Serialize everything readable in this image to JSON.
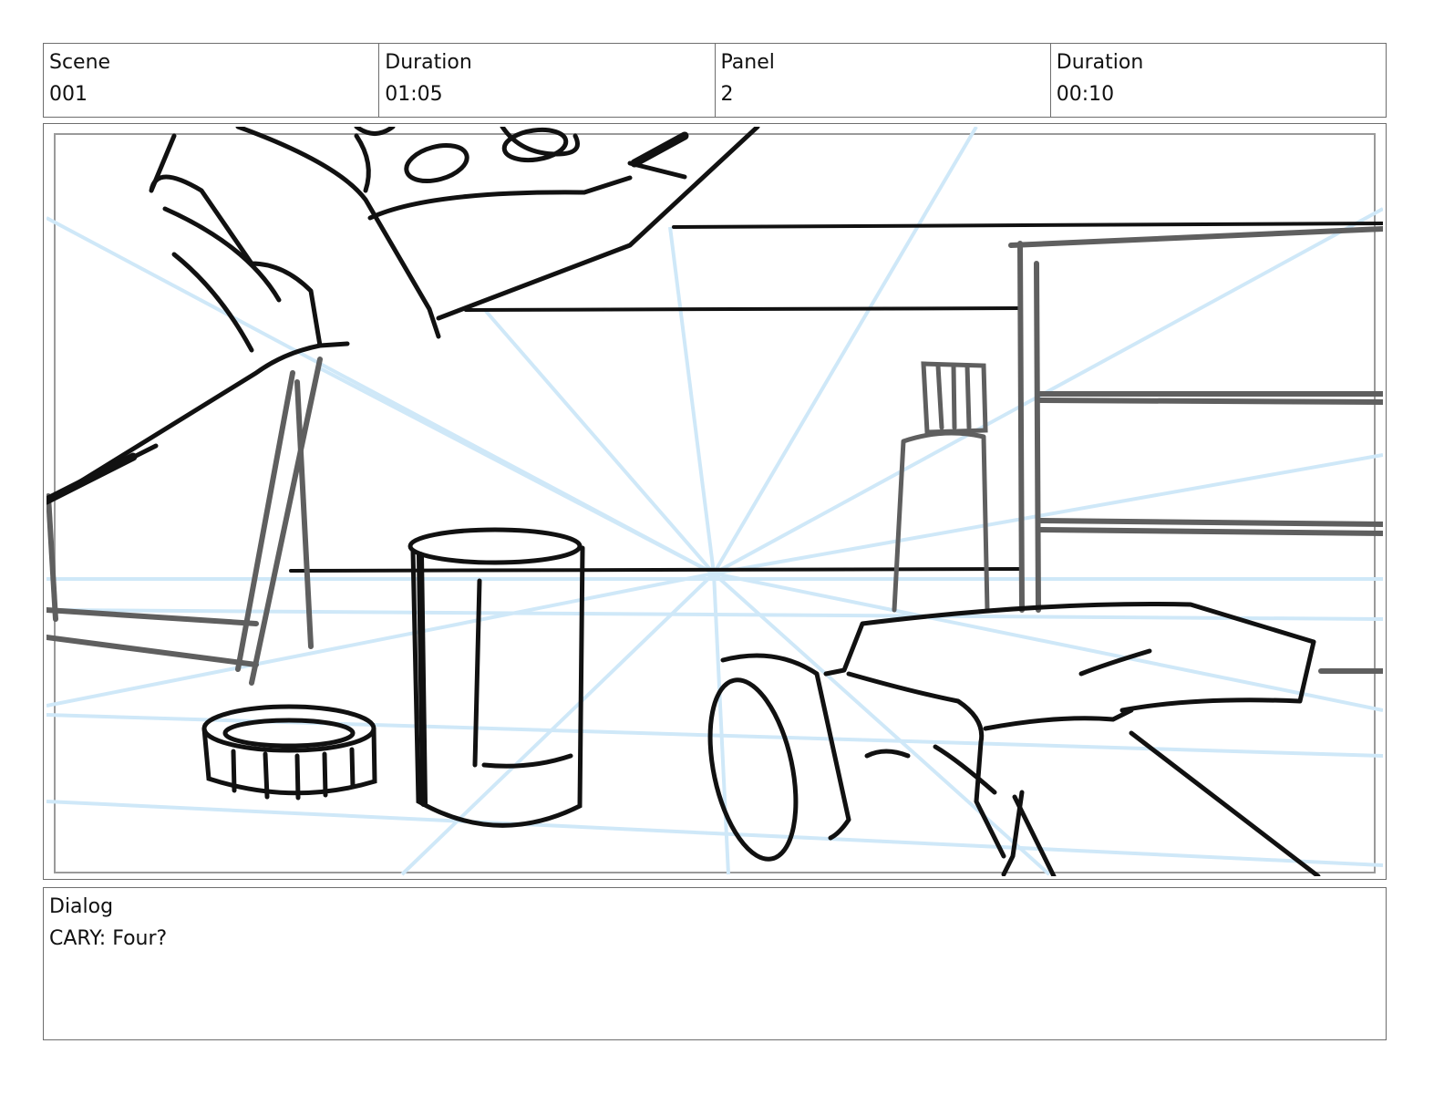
{
  "header": {
    "scene_label": "Scene",
    "scene_value": "001",
    "scene_duration_label": "Duration",
    "scene_duration_value": "01:05",
    "panel_label": "Panel",
    "panel_value": "2",
    "panel_duration_label": "Duration",
    "panel_duration_value": "00:10"
  },
  "dialog": {
    "label": "Dialog",
    "text": "CARY: Four?"
  },
  "colors": {
    "perspective_lines": "#cfe8f8",
    "ink": "#111111",
    "gray_ink": "#5f5f5f",
    "border": "#6e6e6e"
  }
}
